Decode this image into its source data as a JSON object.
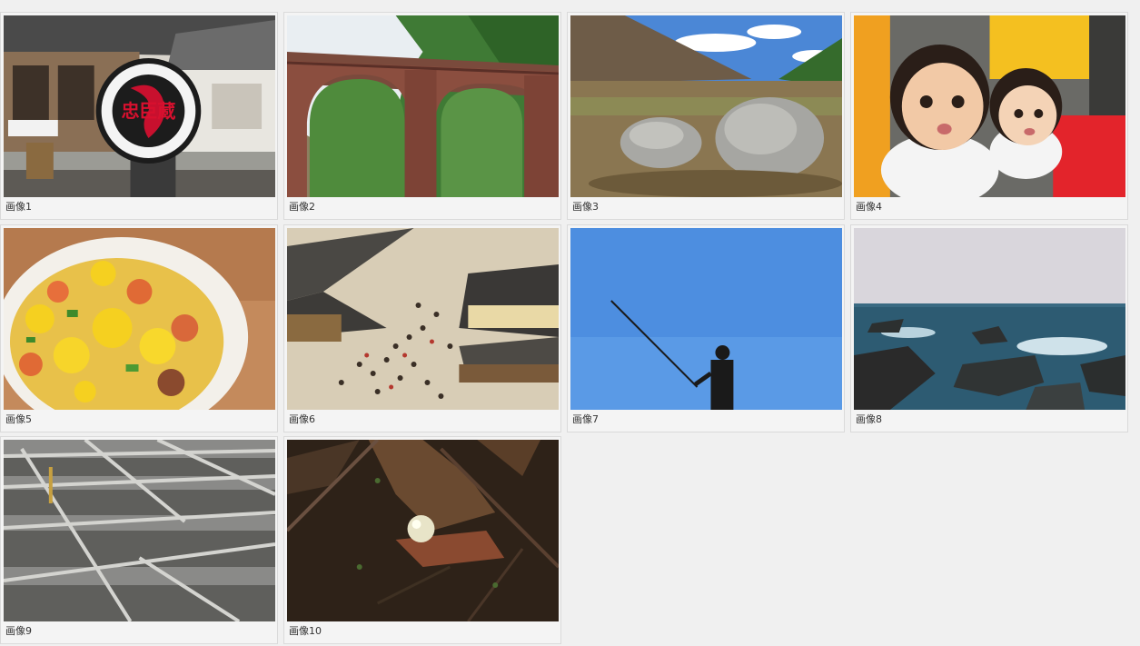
{
  "gallery": {
    "items": [
      {
        "caption": "画像1"
      },
      {
        "caption": "画像2"
      },
      {
        "caption": "画像3"
      },
      {
        "caption": "画像4"
      },
      {
        "caption": "画像5"
      },
      {
        "caption": "画像6"
      },
      {
        "caption": "画像7"
      },
      {
        "caption": "画像8"
      },
      {
        "caption": "画像9"
      },
      {
        "caption": "画像10"
      }
    ],
    "sign_text": "忠臣蔵"
  }
}
